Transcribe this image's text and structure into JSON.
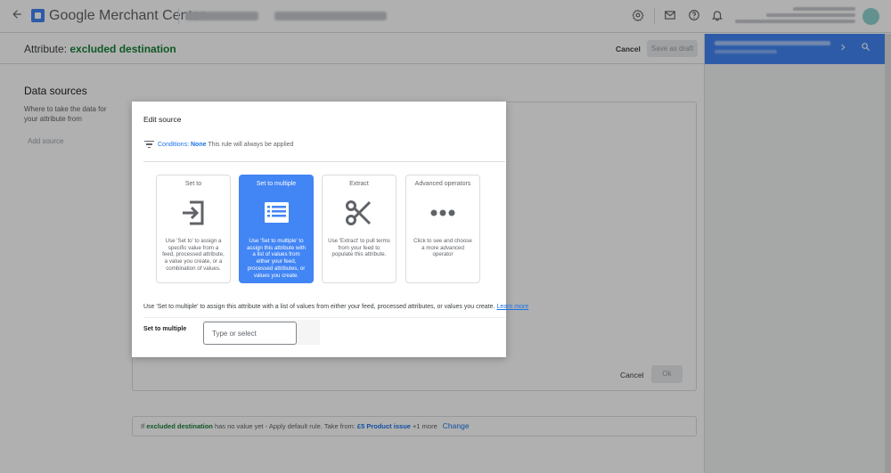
{
  "app": {
    "title": "Google Merchant Center"
  },
  "header": {
    "attribute_prefix": "Attribute: ",
    "attribute_name": "excluded destination",
    "cancel_label": "Cancel",
    "save_draft_label": "Save as draft"
  },
  "data_sources": {
    "title": "Data sources",
    "description": "Where to take the data for your attribute from",
    "add_source_label": "Add source"
  },
  "footer_actions": {
    "cancel_label": "Cancel",
    "ok_label": "Ok"
  },
  "info_bar": {
    "prefix": "If ",
    "attribute": "excluded destination",
    "middle": " has no value yet - Apply default rule. Take from: ",
    "source": "£5 Product issue",
    "suffix": " +1 more",
    "change_label": "Change"
  },
  "modal": {
    "title": "Edit source",
    "conditions_label": "Conditions:",
    "conditions_value": "None",
    "conditions_note": "This rule will always be applied",
    "options": [
      {
        "title": "Set to",
        "icon": "input-arrow-icon",
        "description": "Use 'Set to' to assign a specific value from a feed, processed attribute, a value you create, or a combination of values."
      },
      {
        "title": "Set to multiple",
        "icon": "list-icon",
        "description": "Use 'Set to multiple' to assign this attribute with a list of values from either your feed, processed attributes, or values you create."
      },
      {
        "title": "Extract",
        "icon": "scissors-icon",
        "description": "Use 'Extract' to pull terms from your feed to populate this attribute."
      },
      {
        "title": "Advanced operators",
        "icon": "more-horiz-icon",
        "description": "Click to see and choose a more advanced operator"
      }
    ],
    "selected_option": "Set to multiple",
    "help_text": "Use 'Set to multiple' to assign this attribute with a list of values from either your feed, processed attributes, or values you create.",
    "learn_more_label": "Learn more",
    "field_label": "Set to multiple",
    "field_placeholder": "Type or select"
  },
  "icons": {
    "back": "arrow-back-icon",
    "settings": "gear-icon",
    "mail": "mail-icon",
    "help": "help-icon",
    "notifications": "bell-icon",
    "side_next": "chevron-right-icon",
    "side_search": "search-icon"
  },
  "colors": {
    "accent": "#4285f4",
    "attribute_green": "#188038",
    "link_blue": "#1a73e8"
  }
}
